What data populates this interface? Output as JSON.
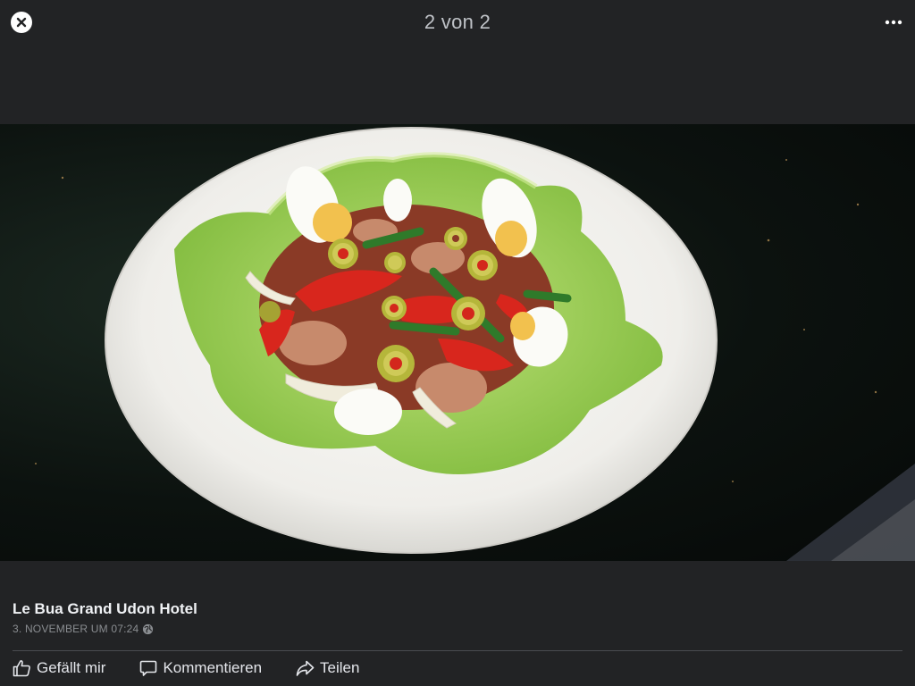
{
  "viewer": {
    "counter": "2 von 2"
  },
  "post": {
    "page_name": "Le Bua Grand Udon Hotel",
    "date": "3. NOVEMBER UM 07:24",
    "privacy_icon": "globe-icon"
  },
  "actions": {
    "like": "Gefällt mir",
    "comment": "Kommentieren",
    "share": "Teilen"
  },
  "colors": {
    "background": "#222325",
    "text": "#e4e6eb",
    "muted": "#8a8d91"
  }
}
